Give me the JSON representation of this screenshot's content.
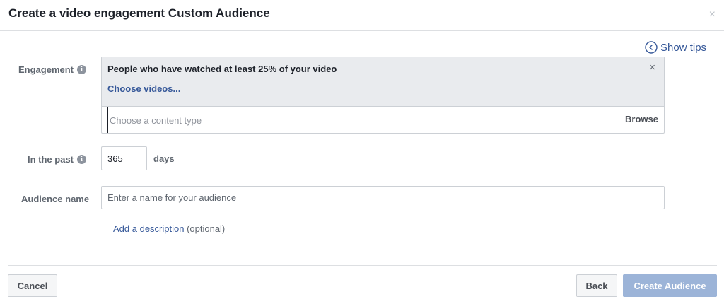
{
  "dialog": {
    "title": "Create a video engagement Custom Audience",
    "close_icon": "×"
  },
  "tips": {
    "label": "Show tips",
    "icon": "chevron-left-circle-icon"
  },
  "engagement": {
    "label": "Engagement",
    "info_icon": "i",
    "selected_option": "People who have watched at least 25% of your video",
    "remove_icon": "×",
    "choose_videos": "Choose videos...",
    "content_type_placeholder": "Choose a content type",
    "browse_label": "Browse"
  },
  "past": {
    "label": "In the past",
    "info_icon": "i",
    "value": "365",
    "unit": "days"
  },
  "audience_name": {
    "label": "Audience name",
    "placeholder": "Enter a name for your audience"
  },
  "description": {
    "link": "Add a description",
    "optional": " (optional)"
  },
  "footer": {
    "cancel": "Cancel",
    "back": "Back",
    "create": "Create Audience"
  },
  "colors": {
    "link": "#365899",
    "primary_disabled": "#9cb4d8",
    "selected_bg": "#e9ebee"
  }
}
